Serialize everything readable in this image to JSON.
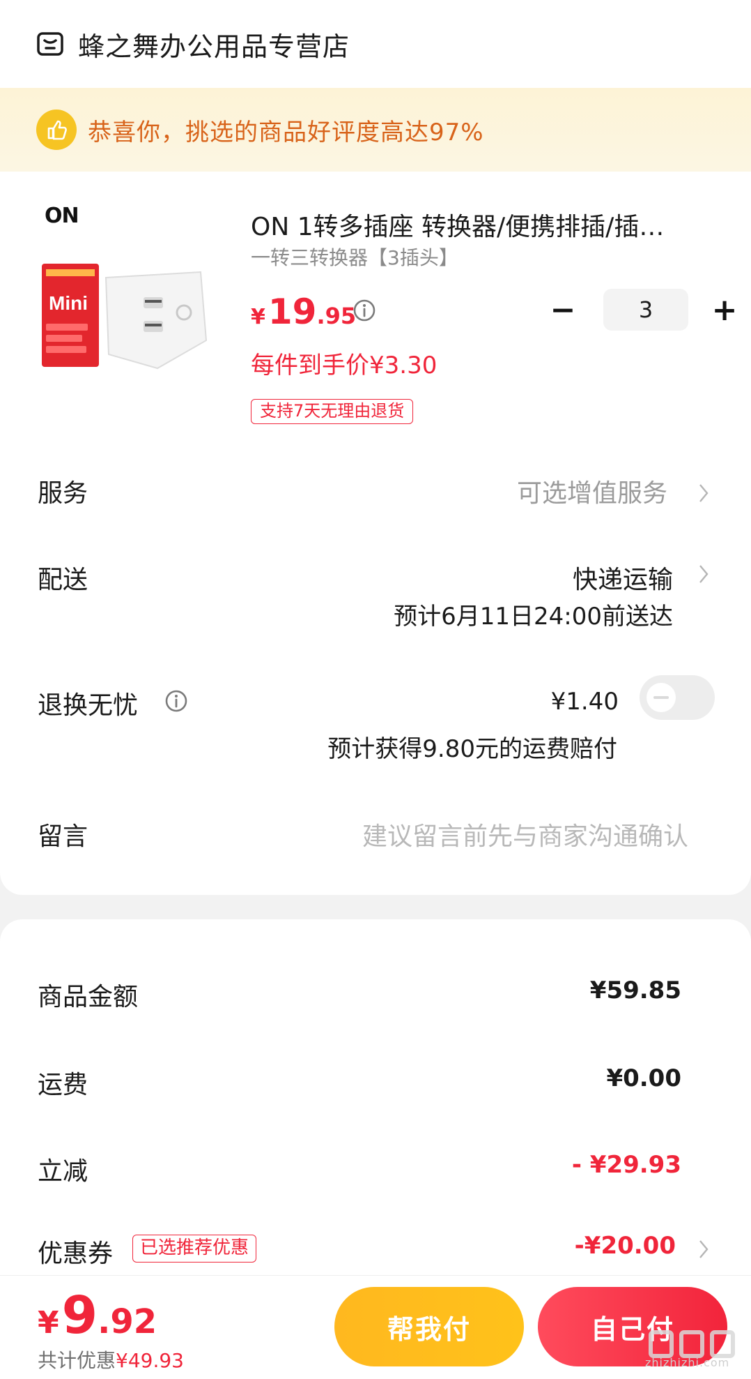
{
  "store": {
    "name": "蜂之舞办公用品专营店",
    "icon": "store-icon"
  },
  "banner": {
    "text": "恭喜你，挑选的商品好评度高达97%",
    "icon": "thumbs-up-icon"
  },
  "product": {
    "logo_text": "ON",
    "image_label": "Mini",
    "title": "ON 1转多插座 转换器/便携排插/插…",
    "spec": "一转三转换器【3插头】",
    "price": {
      "currency": "¥",
      "integer": "19",
      "decimal": ".95"
    },
    "unit_price": "每件到手价¥3.30",
    "return_tag": "支持7天无理由退货",
    "quantity": "3",
    "minus_label": "−",
    "plus_label": "+"
  },
  "options": {
    "service": {
      "label": "服务",
      "value": "可选增值服务"
    },
    "delivery": {
      "label": "配送",
      "value": "快递运输",
      "eta": "预计6月11日24:00前送达"
    },
    "return_insurance": {
      "label": "退换无忧",
      "price": "¥1.40",
      "note": "预计获得9.80元的运费赔付",
      "enabled": false
    },
    "message": {
      "label": "留言",
      "placeholder": "建议留言前先与商家沟通确认"
    }
  },
  "summary": {
    "goods_amount": {
      "label": "商品金额",
      "value": "¥59.85"
    },
    "shipping": {
      "label": "运费",
      "value": "¥0.00"
    },
    "instant_discount": {
      "label": "立减",
      "value": "- ¥29.93"
    },
    "coupon": {
      "label": "优惠券",
      "tag": "已选推荐优惠",
      "value": "-¥20.00"
    }
  },
  "footer": {
    "total": {
      "currency": "¥",
      "integer": "9",
      "decimal": ".92"
    },
    "saved_label": "共计优惠",
    "saved_value": "¥49.93",
    "help_pay_label": "帮我付",
    "pay_label": "自己付",
    "watermark_text": "zhizhizhi.com"
  },
  "colors": {
    "accent_red": "#f0253a",
    "banner_orange": "#d8631a",
    "help_pay_yellow": "#ffb81f"
  }
}
